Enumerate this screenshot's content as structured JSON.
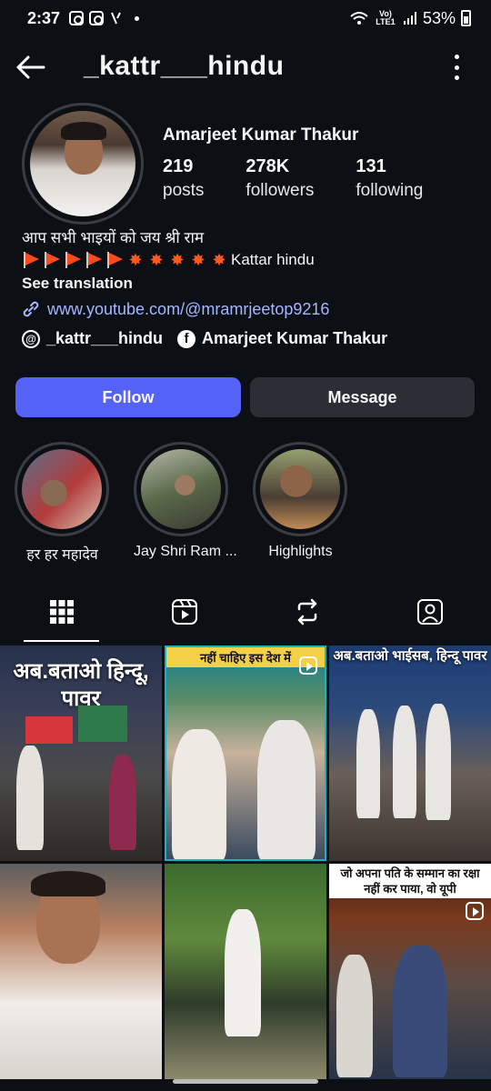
{
  "status_bar": {
    "time": "2:37",
    "lte_label": "Vo) LTE1",
    "battery": "53%"
  },
  "header": {
    "username": "_kattr___hindu"
  },
  "profile": {
    "name": "Amarjeet Kumar Thakur",
    "stats": [
      {
        "value": "219",
        "label": "posts"
      },
      {
        "value": "278K",
        "label": "followers"
      },
      {
        "value": "131",
        "label": "following"
      }
    ]
  },
  "bio": {
    "line1": "आप सभी भाइयों को जय श्री राम",
    "line2_text": "Kattar hindu",
    "see_translation": "See translation",
    "link": "www.youtube.com/@mramrjeetop9216"
  },
  "social": {
    "threads_handle": "_kattr___hindu",
    "facebook_name": "Amarjeet Kumar Thakur"
  },
  "buttons": {
    "follow": "Follow",
    "message": "Message"
  },
  "highlights": [
    {
      "label": "हर हर महादेव"
    },
    {
      "label": "Jay Shri Ram ..."
    },
    {
      "label": "Highlights"
    }
  ],
  "posts": [
    {
      "text": "अब.बताओ हिन्दू, पावर"
    },
    {
      "text": "नहीं चाहिए इस देश में"
    },
    {
      "text": "अब.बताओ भाईसब, हिन्दू पावर"
    },
    {
      "text": ""
    },
    {
      "text": ""
    },
    {
      "text": "जो अपना पति के सम्मान का रक्षा नहीं कर पाया, वो यूपी"
    }
  ],
  "colors": {
    "background": "#0c0f14",
    "follow_button": "#5462f5",
    "message_button": "#2b2e35",
    "link": "#a7b6ff"
  }
}
